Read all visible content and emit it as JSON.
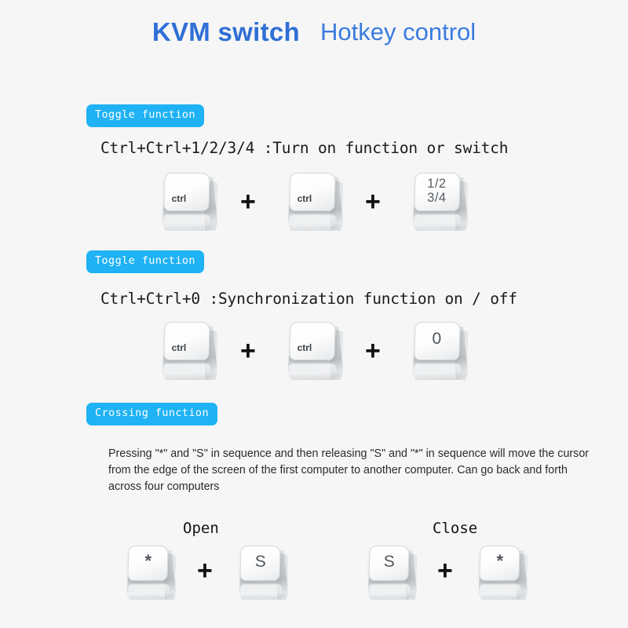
{
  "header": {
    "title_main": "KVM switch",
    "title_sub": "Hotkey control"
  },
  "sections": [
    {
      "badge": "Toggle function",
      "instruction": "Ctrl+Ctrl+1/2/3/4 :Turn on function or switch",
      "keys": [
        "ctrl",
        "ctrl",
        "1/2\n3/4"
      ],
      "separators": [
        "+",
        "+"
      ]
    },
    {
      "badge": "Toggle function",
      "instruction": "Ctrl+Ctrl+0 :Synchronization function on / off",
      "keys": [
        "ctrl",
        "ctrl",
        "0"
      ],
      "separators": [
        "+",
        "+"
      ]
    },
    {
      "badge": "Crossing function",
      "paragraph": "Pressing \"*\" and \"S\" in sequence and then releasing \"S\" and \"*\" in sequence will move the cursor from the edge of the screen of the first computer to another computer. Can go back and forth across four computers",
      "groups": [
        {
          "label": "Open",
          "keys": [
            "*",
            "S"
          ],
          "separator": "+"
        },
        {
          "label": "Close",
          "keys": [
            "S",
            "*"
          ],
          "separator": "+"
        }
      ]
    }
  ],
  "colors": {
    "badge_background": "#1fb2f4",
    "badge_text": "#ffffff",
    "title_main": "#2f6fd6",
    "title_sub": "#3a7ce0",
    "page_background": "#f6f6f6",
    "keycap_top": "#ffffff",
    "keycap_base": "#d5d8da",
    "legend_text": "#4a4f54"
  },
  "icons": {
    "separator": "plus-icon",
    "keycap": "keycap-icon"
  }
}
